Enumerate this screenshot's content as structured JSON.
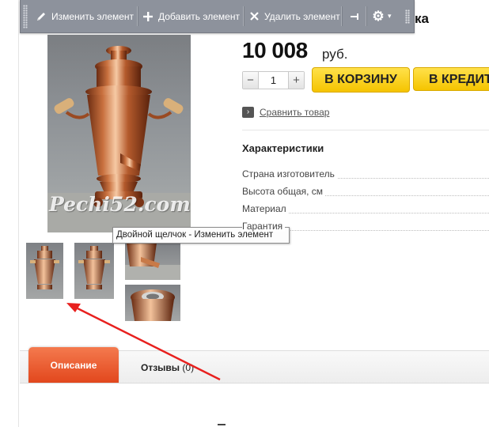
{
  "toolbar": {
    "edit_label": "Изменить элемент",
    "add_label": "Добавить элемент",
    "delete_label": "Удалить элемент"
  },
  "product": {
    "title_visible_fragment": "ка",
    "price": "10 008",
    "currency": "руб.",
    "quantity": "1",
    "minus_label": "−",
    "plus_label": "+",
    "cart_button": "В КОРЗИНУ",
    "credit_button": "В КРЕДИТ",
    "compare_link": "Сравнить товар",
    "photo_watermark": "Pechi52.com"
  },
  "characteristics": {
    "title": "Характеристики",
    "rows": [
      "Страна изготовитель",
      "Высота общая, см",
      "Материал",
      "Гарантия"
    ]
  },
  "tooltip": "Двойной щелчок - Изменить элемент",
  "tabs": {
    "description": "Описание",
    "reviews": "Отзывы",
    "reviews_count": "(0)"
  },
  "colors": {
    "toolbar_bg": "#8d929c",
    "buy_button": "#f5c400",
    "active_tab": "#e85a2e",
    "annotation_arrow": "#e8201e"
  }
}
